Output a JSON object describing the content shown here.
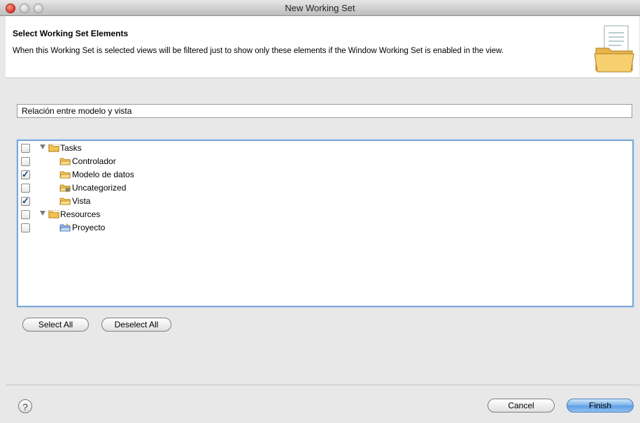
{
  "window": {
    "title": "New Working Set"
  },
  "header": {
    "title": "Select Working Set Elements",
    "description": "When this Working Set is selected views will be filtered just to show only these elements if the Window Working Set is enabled in the view."
  },
  "name_field": {
    "value": "Relación entre modelo y vista"
  },
  "tree": {
    "items": [
      {
        "label": "Tasks",
        "checked": false,
        "expandable": true,
        "icon": "tasks-folder-icon"
      },
      {
        "label": "Controlador",
        "checked": false,
        "expandable": false,
        "icon": "folder-icon"
      },
      {
        "label": "Modelo de datos",
        "checked": true,
        "expandable": false,
        "icon": "folder-icon"
      },
      {
        "label": "Uncategorized",
        "checked": false,
        "expandable": false,
        "icon": "locked-folder-icon"
      },
      {
        "label": "Vista",
        "checked": true,
        "expandable": false,
        "icon": "folder-icon"
      },
      {
        "label": "Resources",
        "checked": false,
        "expandable": true,
        "icon": "resources-folder-icon"
      },
      {
        "label": "Proyecto",
        "checked": false,
        "expandable": false,
        "icon": "project-icon"
      }
    ]
  },
  "buttons": {
    "select_all": "Select All",
    "deselect_all": "Deselect All",
    "cancel": "Cancel",
    "finish": "Finish"
  },
  "help": {
    "icon": "help-icon",
    "glyph": "?"
  },
  "colors": {
    "selection_border": "#7aa7d8",
    "primary_button": "#5d9ee3",
    "folder": "#f2c14e"
  }
}
